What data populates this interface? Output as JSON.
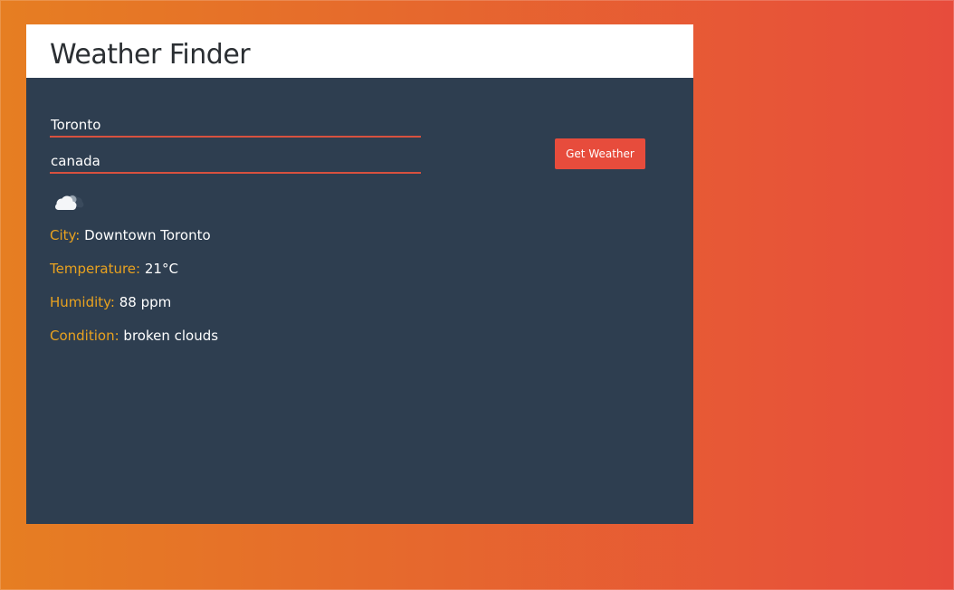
{
  "app": {
    "title": "Weather Finder"
  },
  "form": {
    "city_value": "Toronto",
    "country_value": "canada",
    "submit_label": "Get Weather"
  },
  "result": {
    "icon": "broken-clouds-icon",
    "city": {
      "label": "City:",
      "value": "Downtown Toronto"
    },
    "temperature": {
      "label": "Temperature:",
      "value": "21°C"
    },
    "humidity": {
      "label": "Humidity:",
      "value": "88 ppm"
    },
    "condition": {
      "label": "Condition:",
      "value": "broken clouds"
    }
  },
  "colors": {
    "gradient_start": "#e67e22",
    "gradient_end": "#e74c3c",
    "panel": "#2e3e50",
    "label_accent": "#e9a21f",
    "button": "#e74c3c",
    "input_underline": "#d8513f"
  }
}
